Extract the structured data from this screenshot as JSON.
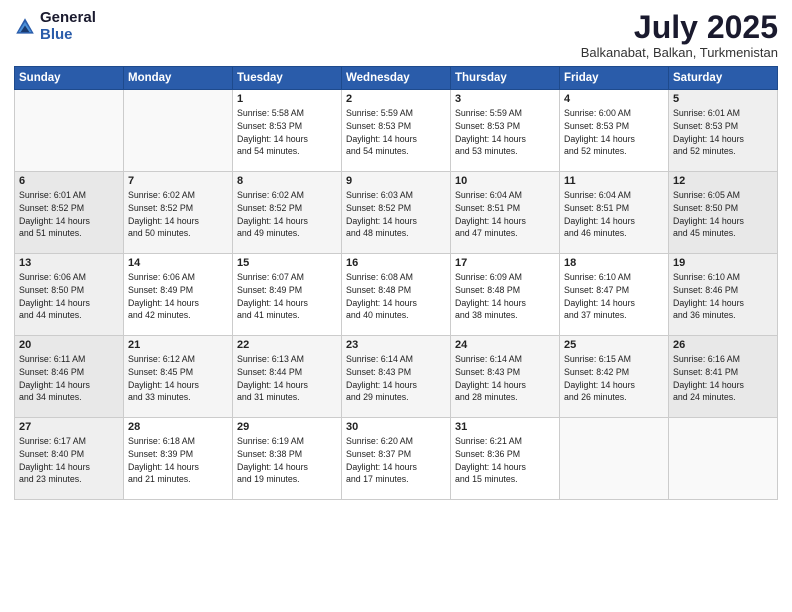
{
  "header": {
    "logo_general": "General",
    "logo_blue": "Blue",
    "month": "July 2025",
    "location": "Balkanabat, Balkan, Turkmenistan"
  },
  "weekdays": [
    "Sunday",
    "Monday",
    "Tuesday",
    "Wednesday",
    "Thursday",
    "Friday",
    "Saturday"
  ],
  "weeks": [
    [
      {
        "day": "",
        "info": ""
      },
      {
        "day": "",
        "info": ""
      },
      {
        "day": "1",
        "info": "Sunrise: 5:58 AM\nSunset: 8:53 PM\nDaylight: 14 hours\nand 54 minutes."
      },
      {
        "day": "2",
        "info": "Sunrise: 5:59 AM\nSunset: 8:53 PM\nDaylight: 14 hours\nand 54 minutes."
      },
      {
        "day": "3",
        "info": "Sunrise: 5:59 AM\nSunset: 8:53 PM\nDaylight: 14 hours\nand 53 minutes."
      },
      {
        "day": "4",
        "info": "Sunrise: 6:00 AM\nSunset: 8:53 PM\nDaylight: 14 hours\nand 52 minutes."
      },
      {
        "day": "5",
        "info": "Sunrise: 6:01 AM\nSunset: 8:53 PM\nDaylight: 14 hours\nand 52 minutes."
      }
    ],
    [
      {
        "day": "6",
        "info": "Sunrise: 6:01 AM\nSunset: 8:52 PM\nDaylight: 14 hours\nand 51 minutes."
      },
      {
        "day": "7",
        "info": "Sunrise: 6:02 AM\nSunset: 8:52 PM\nDaylight: 14 hours\nand 50 minutes."
      },
      {
        "day": "8",
        "info": "Sunrise: 6:02 AM\nSunset: 8:52 PM\nDaylight: 14 hours\nand 49 minutes."
      },
      {
        "day": "9",
        "info": "Sunrise: 6:03 AM\nSunset: 8:52 PM\nDaylight: 14 hours\nand 48 minutes."
      },
      {
        "day": "10",
        "info": "Sunrise: 6:04 AM\nSunset: 8:51 PM\nDaylight: 14 hours\nand 47 minutes."
      },
      {
        "day": "11",
        "info": "Sunrise: 6:04 AM\nSunset: 8:51 PM\nDaylight: 14 hours\nand 46 minutes."
      },
      {
        "day": "12",
        "info": "Sunrise: 6:05 AM\nSunset: 8:50 PM\nDaylight: 14 hours\nand 45 minutes."
      }
    ],
    [
      {
        "day": "13",
        "info": "Sunrise: 6:06 AM\nSunset: 8:50 PM\nDaylight: 14 hours\nand 44 minutes."
      },
      {
        "day": "14",
        "info": "Sunrise: 6:06 AM\nSunset: 8:49 PM\nDaylight: 14 hours\nand 42 minutes."
      },
      {
        "day": "15",
        "info": "Sunrise: 6:07 AM\nSunset: 8:49 PM\nDaylight: 14 hours\nand 41 minutes."
      },
      {
        "day": "16",
        "info": "Sunrise: 6:08 AM\nSunset: 8:48 PM\nDaylight: 14 hours\nand 40 minutes."
      },
      {
        "day": "17",
        "info": "Sunrise: 6:09 AM\nSunset: 8:48 PM\nDaylight: 14 hours\nand 38 minutes."
      },
      {
        "day": "18",
        "info": "Sunrise: 6:10 AM\nSunset: 8:47 PM\nDaylight: 14 hours\nand 37 minutes."
      },
      {
        "day": "19",
        "info": "Sunrise: 6:10 AM\nSunset: 8:46 PM\nDaylight: 14 hours\nand 36 minutes."
      }
    ],
    [
      {
        "day": "20",
        "info": "Sunrise: 6:11 AM\nSunset: 8:46 PM\nDaylight: 14 hours\nand 34 minutes."
      },
      {
        "day": "21",
        "info": "Sunrise: 6:12 AM\nSunset: 8:45 PM\nDaylight: 14 hours\nand 33 minutes."
      },
      {
        "day": "22",
        "info": "Sunrise: 6:13 AM\nSunset: 8:44 PM\nDaylight: 14 hours\nand 31 minutes."
      },
      {
        "day": "23",
        "info": "Sunrise: 6:14 AM\nSunset: 8:43 PM\nDaylight: 14 hours\nand 29 minutes."
      },
      {
        "day": "24",
        "info": "Sunrise: 6:14 AM\nSunset: 8:43 PM\nDaylight: 14 hours\nand 28 minutes."
      },
      {
        "day": "25",
        "info": "Sunrise: 6:15 AM\nSunset: 8:42 PM\nDaylight: 14 hours\nand 26 minutes."
      },
      {
        "day": "26",
        "info": "Sunrise: 6:16 AM\nSunset: 8:41 PM\nDaylight: 14 hours\nand 24 minutes."
      }
    ],
    [
      {
        "day": "27",
        "info": "Sunrise: 6:17 AM\nSunset: 8:40 PM\nDaylight: 14 hours\nand 23 minutes."
      },
      {
        "day": "28",
        "info": "Sunrise: 6:18 AM\nSunset: 8:39 PM\nDaylight: 14 hours\nand 21 minutes."
      },
      {
        "day": "29",
        "info": "Sunrise: 6:19 AM\nSunset: 8:38 PM\nDaylight: 14 hours\nand 19 minutes."
      },
      {
        "day": "30",
        "info": "Sunrise: 6:20 AM\nSunset: 8:37 PM\nDaylight: 14 hours\nand 17 minutes."
      },
      {
        "day": "31",
        "info": "Sunrise: 6:21 AM\nSunset: 8:36 PM\nDaylight: 14 hours\nand 15 minutes."
      },
      {
        "day": "",
        "info": ""
      },
      {
        "day": "",
        "info": ""
      }
    ]
  ]
}
